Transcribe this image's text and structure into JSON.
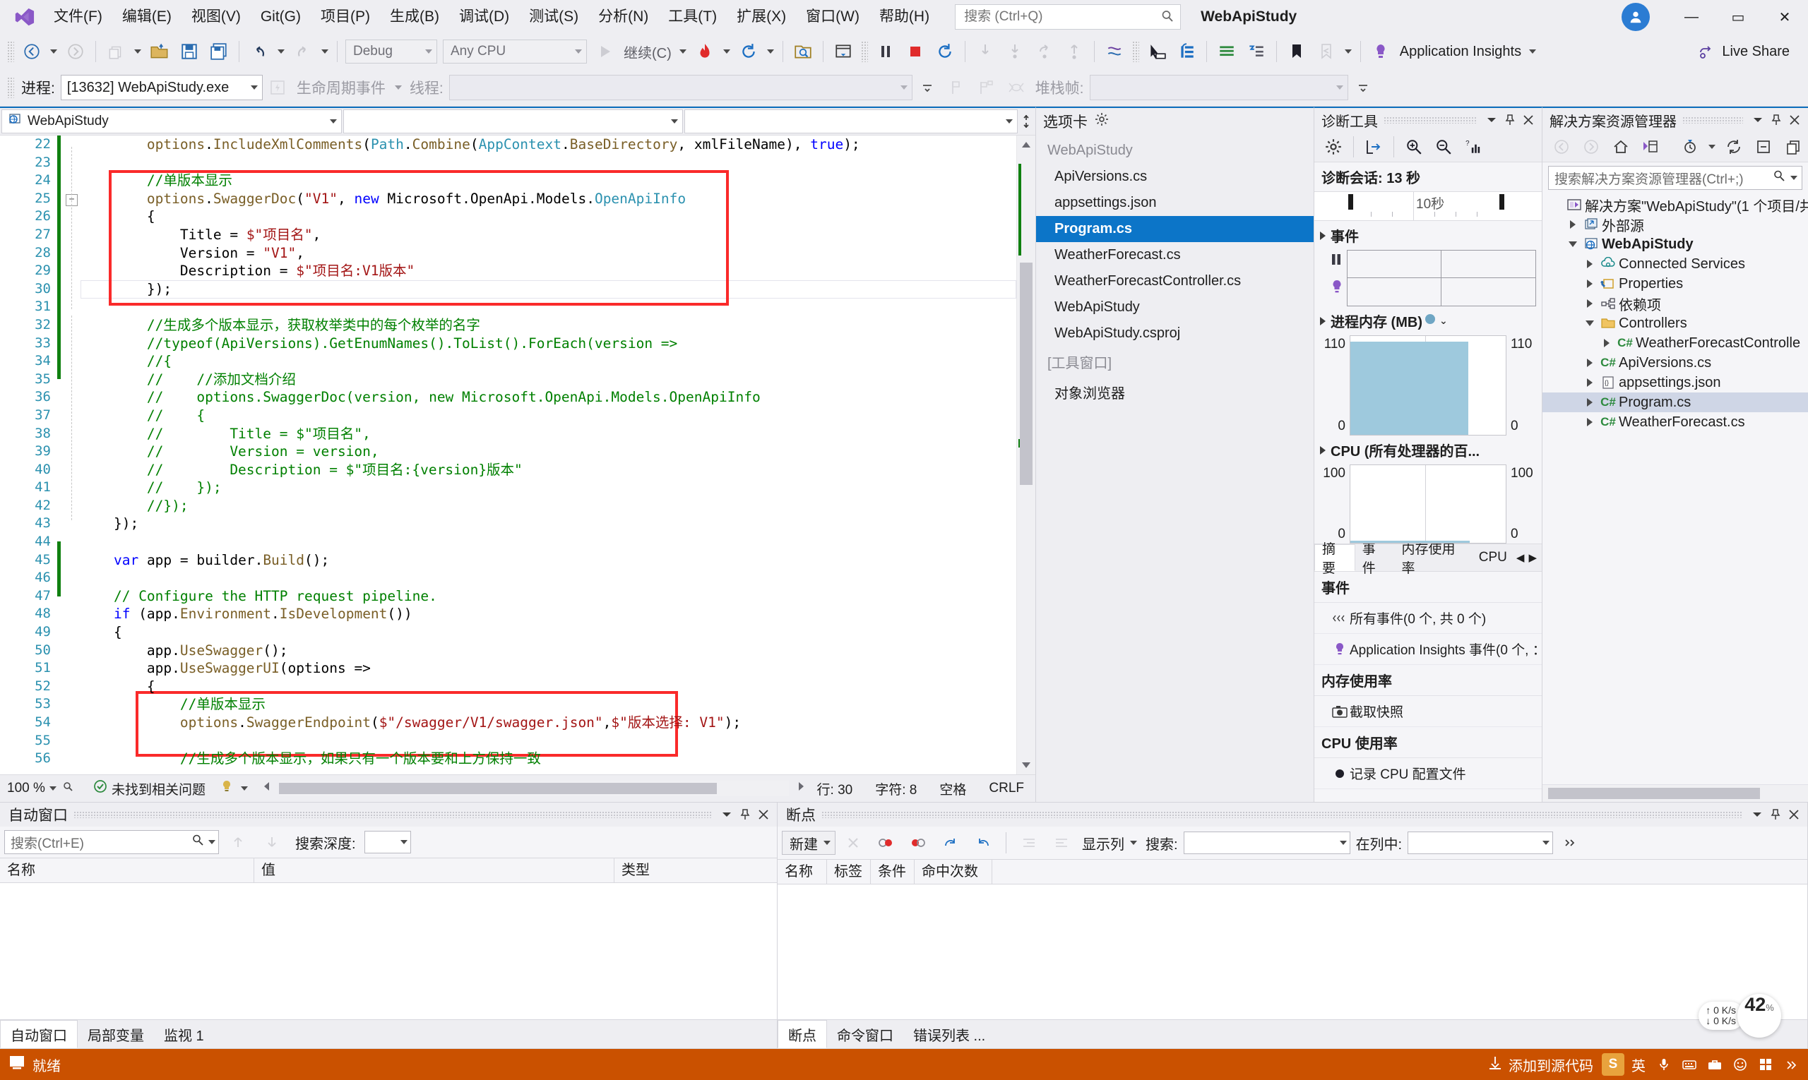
{
  "window": {
    "title": "WebApiStudy",
    "account_initials": "用户"
  },
  "menu": {
    "items": [
      {
        "label": "文件(F)"
      },
      {
        "label": "编辑(E)"
      },
      {
        "label": "视图(V)"
      },
      {
        "label": "Git(G)"
      },
      {
        "label": "项目(P)"
      },
      {
        "label": "生成(B)"
      },
      {
        "label": "调试(D)"
      },
      {
        "label": "测试(S)"
      },
      {
        "label": "分析(N)"
      },
      {
        "label": "工具(T)"
      },
      {
        "label": "扩展(X)"
      },
      {
        "label": "窗口(W)"
      },
      {
        "label": "帮助(H)"
      }
    ]
  },
  "quick_search": {
    "placeholder": "搜索 (Ctrl+Q)",
    "value": ""
  },
  "titlebar_buttons": {
    "minimize": "—",
    "maximize": "▭",
    "close": "✕"
  },
  "toolbar": {
    "config": "Debug",
    "platform": "Any CPU",
    "continue_label": "继续(C)",
    "app_insights": "Application Insights",
    "live_share": "Live Share"
  },
  "debugbar": {
    "process_label": "进程:",
    "process_value": "[13632] WebApiStudy.exe",
    "lifecycle_label": "生命周期事件",
    "thread_label": "线程:",
    "thread_value": "",
    "stackframe_label": "堆栈帧:",
    "stackframe_value": ""
  },
  "editor": {
    "nav_left": "WebApiStudy",
    "nav_mid": "",
    "nav_right": "",
    "first_line_no": 22,
    "lines": [
      {
        "n": 22,
        "html": "        <span class='mth'>options</span>.<span class='mth'>IncludeXmlComments</span>(<span class='ty'>Path</span>.<span class='mth'>Combine</span>(<span class='ty'>AppContext</span>.<span class='mth'>BaseDirectory</span>, xmlFileName), <span class='kw'>true</span>);"
      },
      {
        "n": 23,
        "html": ""
      },
      {
        "n": 24,
        "html": "        <span class='cm'>//单版本显示</span>"
      },
      {
        "n": 25,
        "html": "        <span class='mth'>options</span>.<span class='mth'>SwaggerDoc</span>(<span class='st'>\"V1\"</span>, <span class='kw'>new</span> Microsoft.OpenApi.Models.<span class='ty'>OpenApiInfo</span>"
      },
      {
        "n": 26,
        "html": "        {"
      },
      {
        "n": 27,
        "html": "            Title = <span class='st'>$\"项目名\"</span>,"
      },
      {
        "n": 28,
        "html": "            Version = <span class='st'>\"V1\"</span>,"
      },
      {
        "n": 29,
        "html": "            Description = <span class='st'>$\"项目名:V1版本\"</span>"
      },
      {
        "n": 30,
        "html": "        });"
      },
      {
        "n": 31,
        "html": ""
      },
      {
        "n": 32,
        "html": "        <span class='cm'>//生成多个版本显示，获取枚举类中的每个枚举的名字</span>"
      },
      {
        "n": 33,
        "html": "        <span class='cm'>//typeof(ApiVersions).GetEnumNames().ToList().ForEach(version =></span>"
      },
      {
        "n": 34,
        "html": "        <span class='cm'>//{</span>"
      },
      {
        "n": 35,
        "html": "        <span class='cm'>//    //添加文档介绍</span>"
      },
      {
        "n": 36,
        "html": "        <span class='cm'>//    options.SwaggerDoc(version, new Microsoft.OpenApi.Models.OpenApiInfo</span>"
      },
      {
        "n": 37,
        "html": "        <span class='cm'>//    {</span>"
      },
      {
        "n": 38,
        "html": "        <span class='cm'>//        Title = $\"项目名\",</span>"
      },
      {
        "n": 39,
        "html": "        <span class='cm'>//        Version = version,</span>"
      },
      {
        "n": 40,
        "html": "        <span class='cm'>//        Description = $\"项目名:{version}版本\"</span>"
      },
      {
        "n": 41,
        "html": "        <span class='cm'>//    });</span>"
      },
      {
        "n": 42,
        "html": "        <span class='cm'>//});</span>"
      },
      {
        "n": 43,
        "html": "    });"
      },
      {
        "n": 44,
        "html": ""
      },
      {
        "n": 45,
        "html": "    <span class='kw'>var</span> app = builder.<span class='mth'>Build</span>();"
      },
      {
        "n": 46,
        "html": ""
      },
      {
        "n": 47,
        "html": "    <span class='cm'>// Configure the HTTP request pipeline.</span>"
      },
      {
        "n": 48,
        "html": "    <span class='kw'>if</span> (app.<span class='mth'>Environment</span>.<span class='mth'>IsDevelopment</span>())"
      },
      {
        "n": 49,
        "html": "    {"
      },
      {
        "n": 50,
        "html": "        app.<span class='mth'>UseSwagger</span>();"
      },
      {
        "n": 51,
        "html": "        app.<span class='mth'>UseSwaggerUI</span>(options =>"
      },
      {
        "n": 52,
        "html": "        {"
      },
      {
        "n": 53,
        "html": "            <span class='cm'>//单版本显示</span>"
      },
      {
        "n": 54,
        "html": "            <span class='mth'>options</span>.<span class='mth'>SwaggerEndpoint</span>(<span class='st'>$\"/swagger/V1/swagger.json\"</span>,<span class='st'>$\"版本选择: V1\"</span>);"
      },
      {
        "n": 55,
        "html": ""
      },
      {
        "n": 56,
        "html": "            <span class='cm'>//生成多个版本显示，如果只有一个版本要和上方保持一致</span>"
      }
    ],
    "status": {
      "problems": "未找到相关问题",
      "zoom": "100 %",
      "line": "行: 30",
      "col": "字符: 8",
      "spaces": "空格",
      "eol": "CRLF"
    }
  },
  "options_panel": {
    "title": "选项卡",
    "groups": [
      {
        "label": "WebApiStudy",
        "items": [
          {
            "label": "ApiVersions.cs",
            "selected": false
          },
          {
            "label": "appsettings.json",
            "selected": false
          },
          {
            "label": "Program.cs",
            "selected": true
          },
          {
            "label": "WeatherForecast.cs",
            "selected": false
          },
          {
            "label": "WeatherForecastController.cs",
            "selected": false
          },
          {
            "label": "WebApiStudy",
            "selected": false
          },
          {
            "label": "WebApiStudy.csproj",
            "selected": false
          }
        ]
      },
      {
        "label": "[工具窗口]",
        "items": [
          {
            "label": "对象浏览器",
            "selected": false
          }
        ]
      }
    ]
  },
  "diagnostics": {
    "title": "诊断工具",
    "session": "诊断会话: 13 秒",
    "timeline_label": "10秒",
    "events_section": "事件",
    "memory_section": "进程内存 (MB)",
    "cpu_section": "CPU (所有处理器的百...",
    "tabs": [
      {
        "label": "摘要",
        "selected": true
      },
      {
        "label": "事件",
        "selected": false
      },
      {
        "label": "内存使用率",
        "selected": false
      },
      {
        "label": "CPU",
        "selected": false
      }
    ],
    "summary": [
      {
        "type": "header",
        "label": "事件"
      },
      {
        "type": "row",
        "icon": "events-icon",
        "label": "所有事件(0 个, 共 0 个)"
      },
      {
        "type": "row",
        "icon": "insights-icon",
        "label": "Application Insights 事件(0 个, ："
      },
      {
        "type": "header",
        "label": "内存使用率"
      },
      {
        "type": "row",
        "icon": "camera-icon",
        "label": "截取快照"
      },
      {
        "type": "header",
        "label": "CPU 使用率"
      },
      {
        "type": "row",
        "icon": "record-icon",
        "label": "记录 CPU 配置文件"
      }
    ],
    "chart_data": [
      {
        "type": "area",
        "title": "进程内存 (MB)",
        "ylabel_left": "110",
        "ylabel_left_min": "0",
        "ylabel_right": "110",
        "ylabel_right_min": "0",
        "ylim": [
          0,
          110
        ],
        "values": [
          104,
          104,
          105,
          105,
          105,
          105,
          105,
          104,
          105,
          105,
          105,
          105,
          105
        ],
        "fill_fraction": 0.7,
        "grid": true
      },
      {
        "type": "area",
        "title": "CPU (所有处理器的百...",
        "ylabel_left": "100",
        "ylabel_left_min": "0",
        "ylabel_right": "100",
        "ylabel_right_min": "0",
        "ylim": [
          0,
          100
        ],
        "values": [
          0,
          0,
          0,
          0,
          1,
          0,
          0,
          0,
          0,
          0,
          0,
          0,
          0
        ],
        "fill_fraction": 0.77,
        "grid": true
      }
    ]
  },
  "solution_explorer": {
    "title": "解决方案资源管理器",
    "search_placeholder": "搜索解决方案资源管理器(Ctrl+;)",
    "tree": [
      {
        "label": "解决方案\"WebApiStudy\"(1 个项目/共",
        "depth": 0,
        "icon": "solution-icon",
        "expander": "none",
        "bold": false,
        "selected": false
      },
      {
        "label": "外部源",
        "depth": 1,
        "icon": "external-source-icon",
        "expander": "collapsed",
        "bold": false,
        "selected": false
      },
      {
        "label": "WebApiStudy",
        "depth": 1,
        "icon": "web-project-icon",
        "expander": "expanded",
        "bold": true,
        "selected": false
      },
      {
        "label": "Connected Services",
        "depth": 2,
        "icon": "connected-services-icon",
        "expander": "collapsed",
        "bold": false,
        "selected": false
      },
      {
        "label": "Properties",
        "depth": 2,
        "icon": "properties-icon",
        "expander": "collapsed",
        "bold": false,
        "selected": false
      },
      {
        "label": "依赖项",
        "depth": 2,
        "icon": "dependencies-icon",
        "expander": "collapsed",
        "bold": false,
        "selected": false
      },
      {
        "label": "Controllers",
        "depth": 2,
        "icon": "folder-icon",
        "expander": "expanded",
        "bold": false,
        "selected": false
      },
      {
        "label": "WeatherForecastControlle",
        "depth": 3,
        "icon": "csharp-icon",
        "expander": "collapsed",
        "bold": false,
        "selected": false
      },
      {
        "label": "ApiVersions.cs",
        "depth": 2,
        "icon": "csharp-icon",
        "expander": "collapsed",
        "bold": false,
        "selected": false
      },
      {
        "label": "appsettings.json",
        "depth": 2,
        "icon": "json-icon",
        "expander": "collapsed",
        "bold": false,
        "selected": false
      },
      {
        "label": "Program.cs",
        "depth": 2,
        "icon": "csharp-icon",
        "expander": "collapsed",
        "bold": false,
        "selected": true
      },
      {
        "label": "WeatherForecast.cs",
        "depth": 2,
        "icon": "csharp-icon",
        "expander": "collapsed",
        "bold": false,
        "selected": false
      }
    ]
  },
  "autos_panel": {
    "title": "自动窗口",
    "search_placeholder": "搜索(Ctrl+E)",
    "depth_label": "搜索深度:",
    "depth_value": "",
    "columns": [
      "名称",
      "值",
      "类型"
    ],
    "rows": [],
    "tabs": [
      {
        "label": "自动窗口",
        "selected": true
      },
      {
        "label": "局部变量",
        "selected": false
      },
      {
        "label": "监视 1",
        "selected": false
      }
    ]
  },
  "breakpoints_panel": {
    "title": "断点",
    "new_label": "新建",
    "show_columns_label": "显示列",
    "search_label": "搜索:",
    "search_value": "",
    "in_column_label": "在列中:",
    "in_column_value": "",
    "columns": [
      "名称",
      "标签",
      "条件",
      "命中次数"
    ],
    "rows": [],
    "tabs": [
      {
        "label": "断点",
        "selected": true
      },
      {
        "label": "命令窗口",
        "selected": false
      },
      {
        "label": "错误列表 ...",
        "selected": false
      }
    ]
  },
  "statusbar": {
    "ready": "就绪",
    "source_control": "添加到源代码",
    "ime": "英"
  },
  "net_widget": {
    "up": "0  K/s",
    "down": "0  K/s",
    "value": "42",
    "unit": "%"
  }
}
